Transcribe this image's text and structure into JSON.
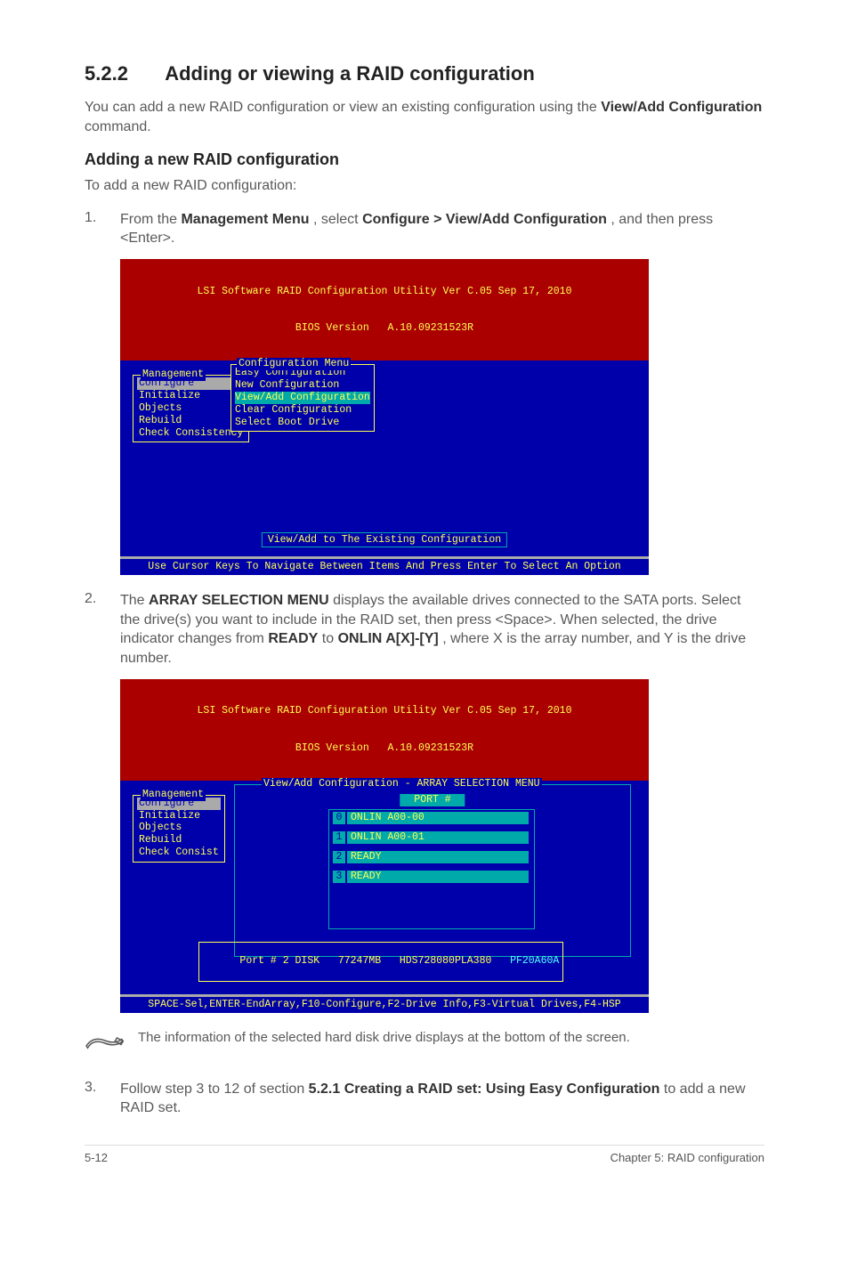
{
  "heading": {
    "number": "5.2.2",
    "title": "Adding or viewing a RAID configuration"
  },
  "intro1": "You can add a new RAID configuration or view an existing configuration using the ",
  "intro1_bold": "View/Add Configuration",
  "intro1_tail": " command.",
  "sub1": "Adding a new RAID configuration",
  "sub1_body": "To add a new RAID configuration:",
  "steps": {
    "s1": {
      "num": "1.",
      "pre": "From the ",
      "b1": "Management Menu",
      "mid": ", select ",
      "b2": "Configure > View/Add Configuration",
      "post": ", and then press <Enter>."
    },
    "s2": {
      "num": "2.",
      "pre": "The ",
      "b1": "ARRAY SELECTION MENU",
      "mid": " displays the available drives connected to the SATA ports. Select the drive(s) you want to include in the RAID set, then press <Space>. When selected, the drive indicator changes from ",
      "b2": "READY",
      "mid2": " to ",
      "b3": "ONLIN A[X]-[Y]",
      "post": ", where X is the array number, and Y is the drive number."
    },
    "s3": {
      "num": "3.",
      "pre": "Follow step 3 to 12 of section ",
      "b1": "5.2.1 Creating a RAID set: Using Easy Configuration",
      "post": " to add a new RAID set."
    }
  },
  "bios1": {
    "title1": "LSI Software RAID Configuration Utility Ver C.05 Sep 17, 2010",
    "title2": "BIOS Version   A.10.09231523R",
    "mgmt_label": "Management",
    "mgmt_items": [
      "Configure",
      "Initialize",
      "Objects",
      "Rebuild",
      "Check Consistency"
    ],
    "conf_label": "Configuration Menu",
    "conf_items": [
      "Easy Configuration",
      "New Configuration",
      "View/Add Configuration",
      "Clear Configuration",
      "Select Boot Drive"
    ],
    "prompt": "View/Add to The Existing Configuration",
    "help": "Use Cursor Keys To Navigate Between Items And Press Enter To Select An Option"
  },
  "bios2": {
    "title1": "LSI Software RAID Configuration Utility Ver C.05 Sep 17, 2010",
    "title2": "BIOS Version   A.10.09231523R",
    "mgmt_label": "Management",
    "mgmt_items": [
      "Configure",
      "Initialize",
      "Objects",
      "Rebuild",
      "Check Consist"
    ],
    "array_label": "View/Add Configuration - ARRAY SELECTION MENU",
    "port_label": "PORT #",
    "drives": [
      {
        "slot": "0",
        "status": "ONLIN A00-00"
      },
      {
        "slot": "1",
        "status": "ONLIN A00-01"
      },
      {
        "slot": "2",
        "status": "READY"
      },
      {
        "slot": "3",
        "status": "READY"
      }
    ],
    "info_pre": "Port # 2 DISK   77247MB   HDS728080PLA380   ",
    "info_hl": "PF20A60A",
    "help": "SPACE-Sel,ENTER-EndArray,F10-Configure,F2-Drive Info,F3-Virtual Drives,F4-HSP"
  },
  "note": "The information of the selected hard disk drive displays at the bottom of the screen.",
  "footer": {
    "left": "5-12",
    "right": "Chapter 5: RAID configuration"
  }
}
